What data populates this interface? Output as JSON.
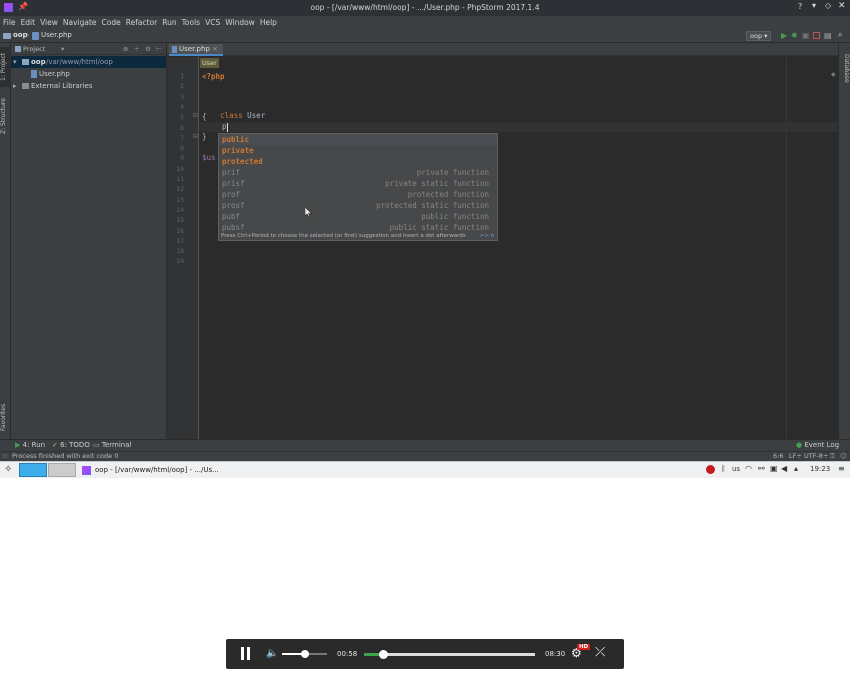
{
  "titlebar": {
    "title": "oop - [/var/www/html/oop] - .../User.php - PhpStorm 2017.1.4"
  },
  "menu": [
    "File",
    "Edit",
    "View",
    "Navigate",
    "Code",
    "Refactor",
    "Run",
    "Tools",
    "VCS",
    "Window",
    "Help"
  ],
  "navbar": {
    "crumb_project": "oop",
    "crumb_file": "User.php",
    "run_config": "oop"
  },
  "side_tabs": {
    "project": "1: Project",
    "structure": "Z: Structure",
    "favorites": "Favorites",
    "database": "Database"
  },
  "project": {
    "header": "Project",
    "items": [
      {
        "label": "oop",
        "path": "/var/www/html/oop"
      },
      {
        "label": "User.php"
      },
      {
        "label": "External Libraries"
      }
    ]
  },
  "editor": {
    "tab": "User.php",
    "breadcrumb": "User",
    "line_numbers": [
      "1",
      "2",
      "3",
      "4",
      "5",
      "6",
      "7",
      "8",
      "9",
      "10",
      "11",
      "12",
      "13",
      "14",
      "15",
      "16",
      "17",
      "18",
      "19"
    ],
    "code": {
      "php_open": "<?php",
      "kw_class": "class",
      "class_name": "User",
      "brace_open": "{",
      "typed": "p",
      "brace_close": "}",
      "var_prefix": "$us"
    }
  },
  "autocomplete": {
    "suggestions": [
      {
        "name": "public",
        "desc": ""
      },
      {
        "name": "private",
        "desc": ""
      },
      {
        "name": "protected",
        "desc": ""
      },
      {
        "name": "prif",
        "desc": "private function"
      },
      {
        "name": "prisf",
        "desc": "private static function"
      },
      {
        "name": "prof",
        "desc": "protected function"
      },
      {
        "name": "prosf",
        "desc": "protected static function"
      },
      {
        "name": "pubf",
        "desc": "public function"
      },
      {
        "name": "pubsf",
        "desc": "public static function"
      }
    ],
    "hint": "Press Ctrl+Period to choose the selected (or first) suggestion and insert a dot afterwards",
    "hint_link": ">> π"
  },
  "bottom_tools": {
    "run": "4: Run",
    "todo": "6: TODO",
    "terminal": "Terminal",
    "event_log": "Event Log"
  },
  "status": {
    "message": "Process finished with exit code 0",
    "position": "6:6",
    "line_sep": "LF÷",
    "encoding": "UTF-8÷"
  },
  "taskbar": {
    "window_title": "oop - [/var/www/html/oop] - .../Us...",
    "keyboard": "us",
    "clock": "19:23"
  },
  "player": {
    "current_time": "00:58",
    "total_time": "08:30",
    "hd_badge": "HD",
    "progress": 0.113,
    "volume": 0.5
  },
  "colors": {
    "keyword": "#cc7832",
    "php_tag": "#cc7832",
    "variable": "#9876aa",
    "accent": "#4a88c7",
    "progress": "#3fa34d"
  }
}
